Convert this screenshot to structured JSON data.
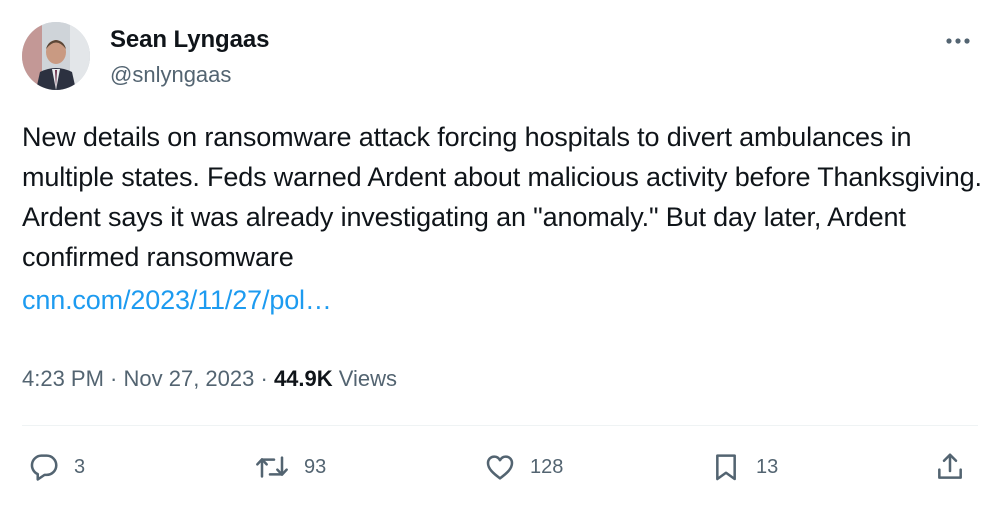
{
  "author": {
    "display_name": "Sean Lyngaas",
    "handle": "@snlyngaas"
  },
  "tweet": {
    "text": "New details on ransomware attack forcing hospitals to divert ambulances in multiple states. Feds warned Ardent about malicious activity before Thanksgiving. Ardent says it was already investigating an \"anomaly.\" But day later, Ardent confirmed ransomware",
    "link": "cnn.com/2023/11/27/pol…"
  },
  "meta": {
    "time": "4:23 PM",
    "separator": " · ",
    "date": "Nov 27, 2023",
    "views_count": "44.9K",
    "views_label": " Views"
  },
  "actions": {
    "replies": "3",
    "reposts": "93",
    "likes": "128",
    "bookmarks": "13"
  },
  "icons": {
    "more": "more-horizontal-icon",
    "reply": "reply-icon",
    "repost": "repost-icon",
    "like": "heart-icon",
    "bookmark": "bookmark-icon",
    "share": "share-icon"
  },
  "colors": {
    "text": "#0f1419",
    "secondary": "#536471",
    "link": "#1d9bf0",
    "divider": "#eff3f4"
  }
}
